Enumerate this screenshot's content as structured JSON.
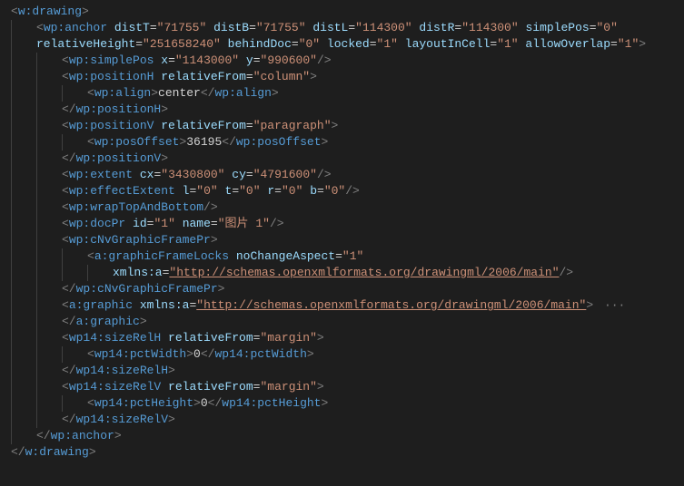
{
  "lines": {
    "l1": {
      "tag": "w:drawing",
      "type": "open",
      "indent": 0
    },
    "l2": {
      "tag": "wp:anchor",
      "type": "open",
      "indent": 1,
      "attrs": [
        {
          "n": "distT",
          "v": "71755"
        },
        {
          "n": "distB",
          "v": "71755"
        },
        {
          "n": "distL",
          "v": "114300"
        },
        {
          "n": "distR",
          "v": "114300"
        },
        {
          "n": "simplePos",
          "v": "0"
        }
      ],
      "noclose": true
    },
    "l3": {
      "indent": 1,
      "attrs": [
        {
          "n": "relativeHeight",
          "v": "251658240"
        },
        {
          "n": "behindDoc",
          "v": "0"
        },
        {
          "n": "locked",
          "v": "1"
        },
        {
          "n": "layoutInCell",
          "v": "1"
        },
        {
          "n": "allowOverlap",
          "v": "1"
        }
      ],
      "cont": true,
      "close": true
    },
    "l4": {
      "tag": "wp:simplePos",
      "type": "self",
      "indent": 2,
      "attrs": [
        {
          "n": "x",
          "v": "1143000"
        },
        {
          "n": "y",
          "v": "990600"
        }
      ]
    },
    "l5": {
      "tag": "wp:positionH",
      "type": "open",
      "indent": 2,
      "attrs": [
        {
          "n": "relativeFrom",
          "v": "column"
        }
      ]
    },
    "l6": {
      "tag": "wp:align",
      "type": "inline",
      "indent": 3,
      "text": "center"
    },
    "l7": {
      "tag": "wp:positionH",
      "type": "close",
      "indent": 2
    },
    "l8": {
      "tag": "wp:positionV",
      "type": "open",
      "indent": 2,
      "attrs": [
        {
          "n": "relativeFrom",
          "v": "paragraph"
        }
      ]
    },
    "l9": {
      "tag": "wp:posOffset",
      "type": "inline",
      "indent": 3,
      "text": "36195"
    },
    "l10": {
      "tag": "wp:positionV",
      "type": "close",
      "indent": 2
    },
    "l11": {
      "tag": "wp:extent",
      "type": "self",
      "indent": 2,
      "attrs": [
        {
          "n": "cx",
          "v": "3430800"
        },
        {
          "n": "cy",
          "v": "4791600"
        }
      ]
    },
    "l12": {
      "tag": "wp:effectExtent",
      "type": "self",
      "indent": 2,
      "attrs": [
        {
          "n": "l",
          "v": "0"
        },
        {
          "n": "t",
          "v": "0"
        },
        {
          "n": "r",
          "v": "0"
        },
        {
          "n": "b",
          "v": "0"
        }
      ]
    },
    "l13": {
      "tag": "wp:wrapTopAndBottom",
      "type": "self",
      "indent": 2
    },
    "l14": {
      "tag": "wp:docPr",
      "type": "self",
      "indent": 2,
      "attrs": [
        {
          "n": "id",
          "v": "1"
        },
        {
          "n": "name",
          "v": "图片 1"
        }
      ]
    },
    "l15": {
      "tag": "wp:cNvGraphicFramePr",
      "type": "open",
      "indent": 2
    },
    "l16": {
      "tag": "a:graphicFrameLocks",
      "type": "open",
      "indent": 3,
      "attrs": [
        {
          "n": "noChangeAspect",
          "v": "1"
        }
      ],
      "noclose": true
    },
    "l17": {
      "indent": 4,
      "attrs": [
        {
          "n": "xmlns:a",
          "v": "http://schemas.openxmlformats.org/drawingml/2006/main",
          "url": true
        }
      ],
      "cont": true,
      "self": true
    },
    "l18": {
      "tag": "wp:cNvGraphicFramePr",
      "type": "close",
      "indent": 2
    },
    "l19": {
      "tag": "a:graphic",
      "type": "open",
      "indent": 2,
      "attrs": [
        {
          "n": "xmlns:a",
          "v": "http://schemas.openxmlformats.org/drawingml/2006/main",
          "url": true
        }
      ],
      "collapsed": true
    },
    "l20": {
      "tag": "a:graphic",
      "type": "close",
      "indent": 2
    },
    "l21": {
      "tag": "wp14:sizeRelH",
      "type": "open",
      "indent": 2,
      "attrs": [
        {
          "n": "relativeFrom",
          "v": "margin"
        }
      ]
    },
    "l22": {
      "tag": "wp14:pctWidth",
      "type": "inline",
      "indent": 3,
      "text": "0"
    },
    "l23": {
      "tag": "wp14:sizeRelH",
      "type": "close",
      "indent": 2
    },
    "l24": {
      "tag": "wp14:sizeRelV",
      "type": "open",
      "indent": 2,
      "attrs": [
        {
          "n": "relativeFrom",
          "v": "margin"
        }
      ]
    },
    "l25": {
      "tag": "wp14:pctHeight",
      "type": "inline",
      "indent": 3,
      "text": "0"
    },
    "l26": {
      "tag": "wp14:sizeRelV",
      "type": "close",
      "indent": 2
    },
    "l27": {
      "tag": "wp:anchor",
      "type": "close",
      "indent": 1
    },
    "l28": {
      "tag": "w:drawing",
      "type": "close",
      "indent": 0
    }
  },
  "order": [
    "l1",
    "l2",
    "l3",
    "l4",
    "l5",
    "l6",
    "l7",
    "l8",
    "l9",
    "l10",
    "l11",
    "l12",
    "l13",
    "l14",
    "l15",
    "l16",
    "l17",
    "l18",
    "l19",
    "l20",
    "l21",
    "l22",
    "l23",
    "l24",
    "l25",
    "l26",
    "l27",
    "l28"
  ]
}
